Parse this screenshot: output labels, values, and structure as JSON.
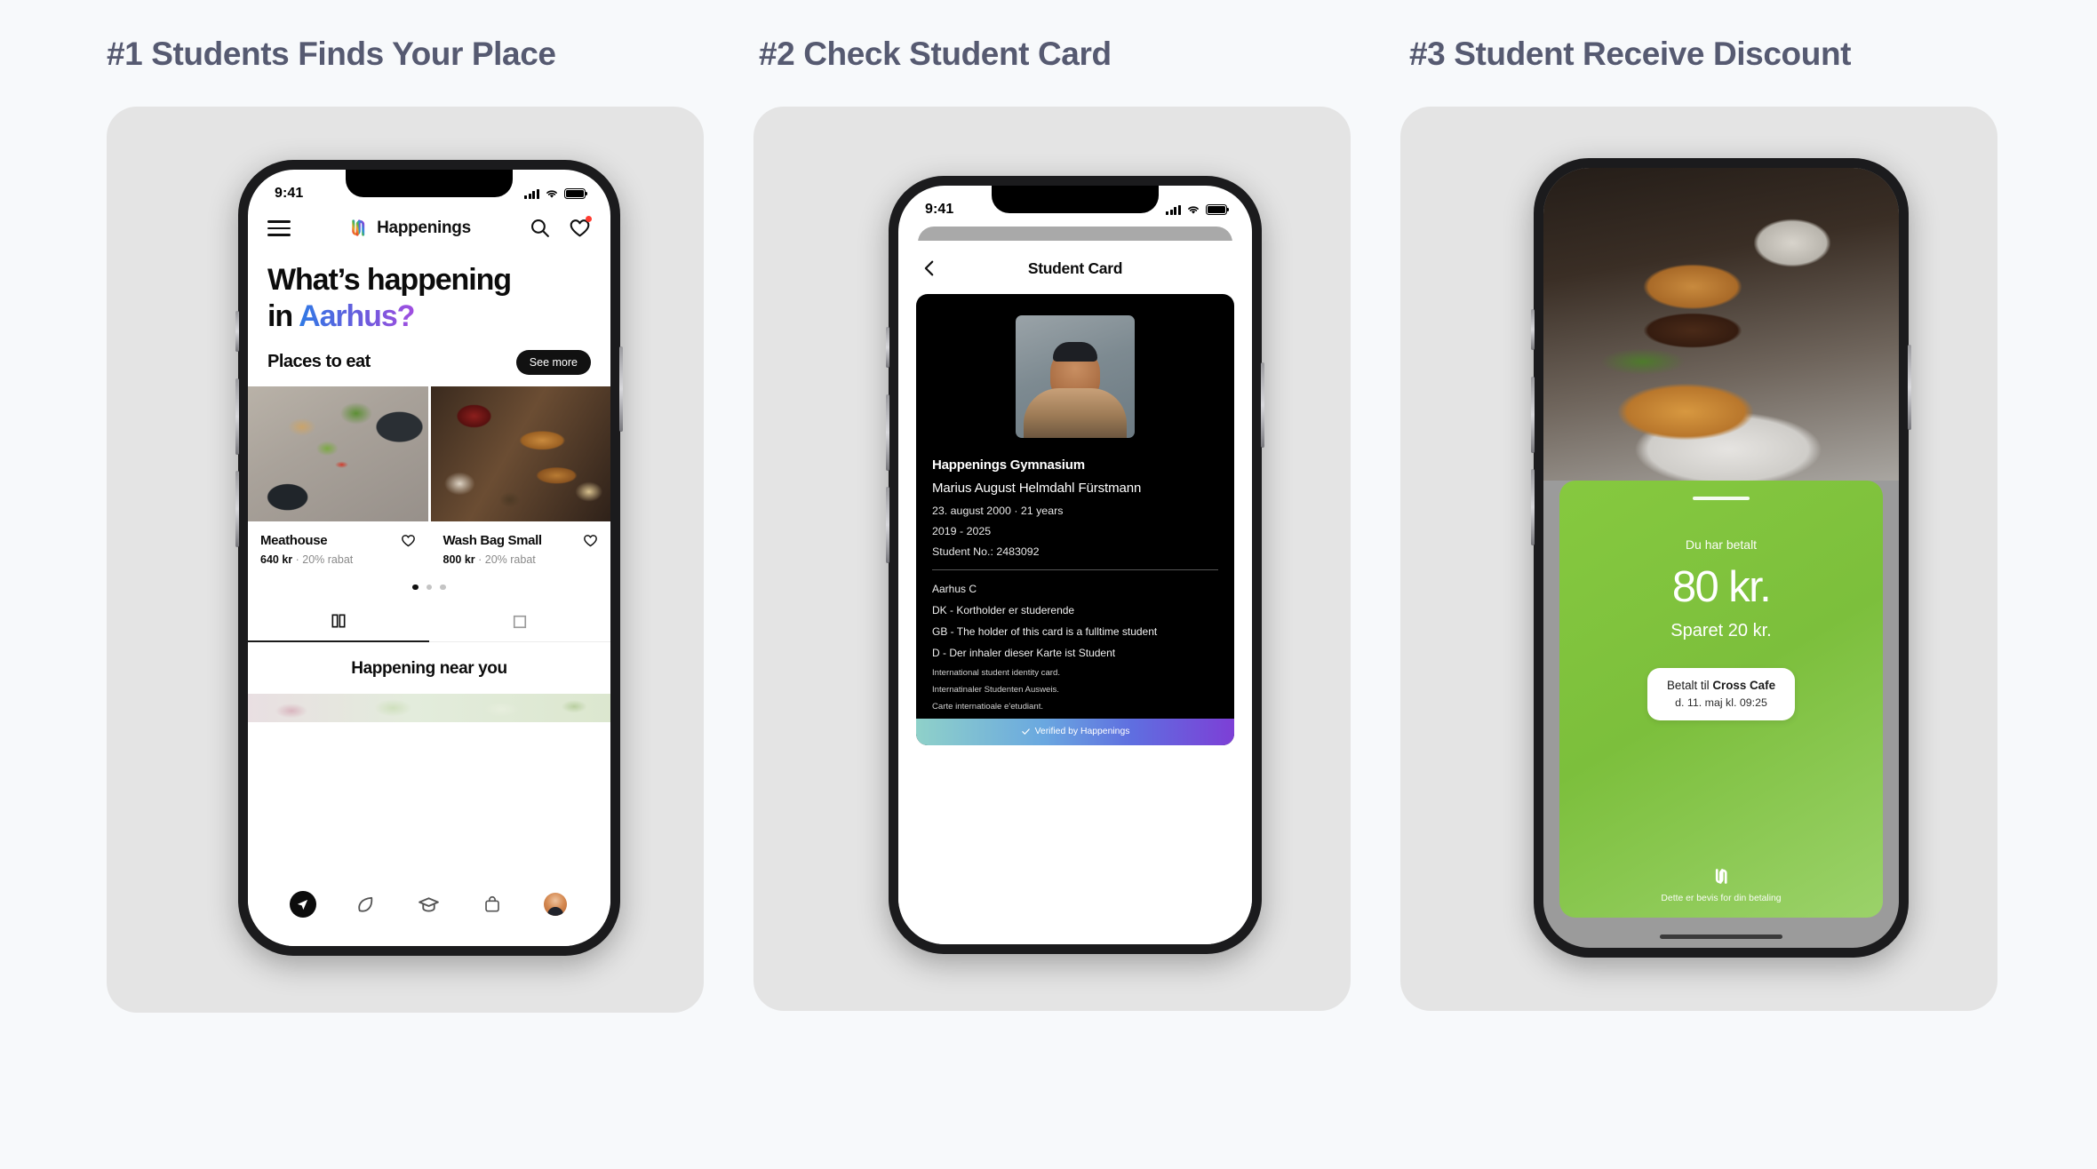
{
  "theme": {
    "page_bg": "#f7f9fb",
    "card_bg": "#e4e4e4",
    "heading_color": "#565a71",
    "accent_green": "#7cc242",
    "gradient_city": "#2f7ae5 -> #a04ee0",
    "badge_red": "#ff3b30"
  },
  "steps": [
    {
      "heading": "#1 Students Finds Your Place"
    },
    {
      "heading": "#2 Check Student Card"
    },
    {
      "heading": "#3 Student Receive Discount"
    }
  ],
  "phone1": {
    "status": {
      "time": "9:41",
      "signal_icon": "signal-bars-icon",
      "wifi_icon": "wifi-icon",
      "battery_icon": "battery-icon"
    },
    "header": {
      "menu_icon": "hamburger-menu-icon",
      "logo_icon": "happenings-logo-icon",
      "brand": "Happenings",
      "search_icon": "search-icon",
      "favorites_icon": "heart-icon"
    },
    "hero": {
      "line1": "What’s happening",
      "line2_prefix": "in ",
      "line2_city": "Aarhus?"
    },
    "section": {
      "title": "Places to eat",
      "see_more": "See more"
    },
    "places": [
      {
        "name": "Meathouse",
        "price": "640 kr",
        "separator": " · ",
        "discount": "20% rabat",
        "favorite_icon": "heart-outline-icon"
      },
      {
        "name": "Wash Bag Small",
        "price": "800 kr",
        "separator": " · ",
        "discount": "20% rabat",
        "favorite_icon": "heart-outline-icon"
      }
    ],
    "carousel": {
      "total_dots": 3,
      "active_index": 0
    },
    "tabs": [
      {
        "icon": "columns-view-icon",
        "active": true
      },
      {
        "icon": "square-view-icon",
        "active": false
      }
    ],
    "near": {
      "title": "Happening near you"
    },
    "tabbar": [
      {
        "icon": "navigation-arrow-icon",
        "active": true
      },
      {
        "icon": "leaf-icon",
        "active": false
      },
      {
        "icon": "graduation-cap-icon",
        "active": false
      },
      {
        "icon": "shopping-bag-icon",
        "active": false
      },
      {
        "icon": "profile-avatar-icon",
        "active": false
      }
    ]
  },
  "phone2": {
    "status": {
      "time": "9:41",
      "signal_icon": "signal-bars-icon",
      "wifi_icon": "wifi-icon",
      "battery_icon": "battery-icon"
    },
    "nav": {
      "back_icon": "chevron-left-icon",
      "title": "Student Card"
    },
    "card": {
      "photo_alt": "student-portrait",
      "school": "Happenings Gymnasium",
      "name": "Marius August Helmdahl Fürstmann",
      "birth": "23. august 2000 · 21 years",
      "years": "2019 - 2025",
      "student_no": "Student No.: 2483092",
      "city": "Aarhus C",
      "lang_dk": "DK - Kortholder er studerende",
      "lang_gb": "GB - The holder of this card is a fulltime student",
      "lang_de": "D - Der inhaler dieser Karte ist Student",
      "small_en": "International student identity card.",
      "small_de": "Internatinaler Studenten Ausweis.",
      "small_fr": "Carte internatioale e'etudiant.",
      "verified_icon": "check-icon",
      "verified": "Verified by Happenings"
    }
  },
  "phone3": {
    "photo_alt": "burger-and-fries",
    "payment": {
      "grip_icon": "drag-handle-icon",
      "label": "Du har betalt",
      "amount": "80 kr.",
      "saved": "Sparet 20 kr.",
      "receipt_prefix": "Betalt til ",
      "receipt_merchant": "Cross Cafe",
      "receipt_time": "d. 11. maj  kl. 09:25",
      "logo_icon": "happenings-logo-icon",
      "note": "Dette er bevis for din betaling"
    }
  }
}
